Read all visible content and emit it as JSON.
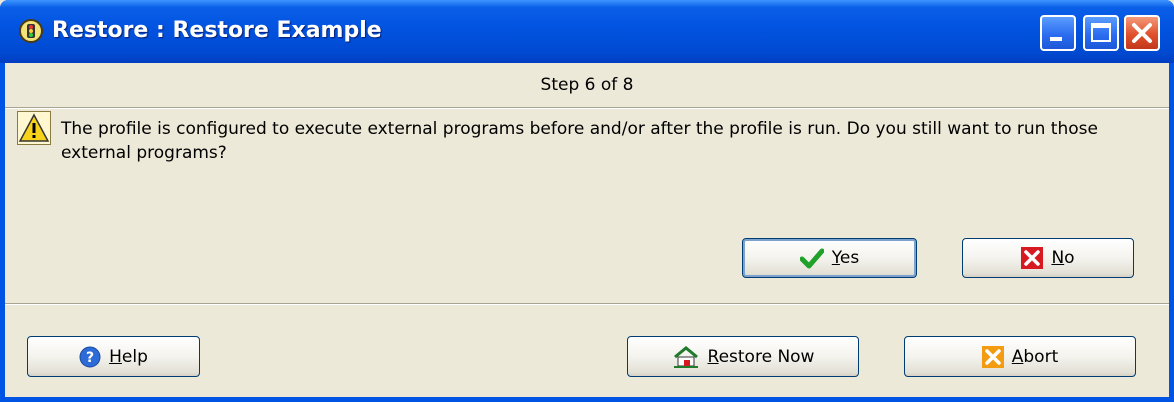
{
  "window": {
    "title": "Restore : Restore Example",
    "controls": {
      "minimize": "minimize-icon",
      "maximize": "maximize-icon",
      "close": "close-icon"
    }
  },
  "wizard": {
    "step": "Step 6 of 8",
    "message": "The profile is configured to execute external programs before and/or after the profile is run. Do you still want to run those external programs?",
    "icon": "warning-icon"
  },
  "prompt_buttons": {
    "yes": {
      "mnemonic": "Y",
      "rest": "es",
      "icon": "checkmark-icon"
    },
    "no": {
      "mnemonic": "N",
      "rest": "o",
      "icon": "red-x-icon"
    }
  },
  "footer_buttons": {
    "help": {
      "mnemonic": "H",
      "rest": "elp",
      "icon": "help-icon"
    },
    "restore_now": {
      "mnemonic": "R",
      "rest": "estore Now",
      "icon": "restore-icon"
    },
    "abort": {
      "mnemonic": "A",
      "rest": "bort",
      "icon": "orange-x-icon"
    }
  },
  "colors": {
    "titlebar": "#0054e3",
    "client": "#ece9d8",
    "close_button": "#e0502d"
  }
}
